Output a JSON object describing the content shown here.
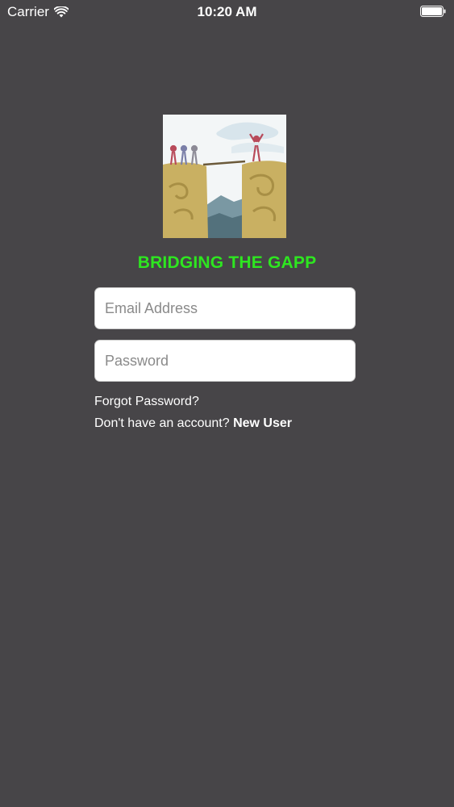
{
  "status_bar": {
    "carrier": "Carrier",
    "time": "10:20 AM"
  },
  "app": {
    "title": "BRIDGING THE GAPP",
    "title_color": "#2ee620",
    "background_color": "#474548"
  },
  "login_form": {
    "email_placeholder": "Email Address",
    "email_value": "",
    "password_placeholder": "Password",
    "password_value": "",
    "forgot_password_label": "Forgot Password?",
    "signup_prompt": "Don't have an account?",
    "new_user_label": "New User"
  },
  "icons": {
    "wifi": "wifi-icon",
    "battery": "battery-icon",
    "logo": "bridge-logo-icon"
  }
}
